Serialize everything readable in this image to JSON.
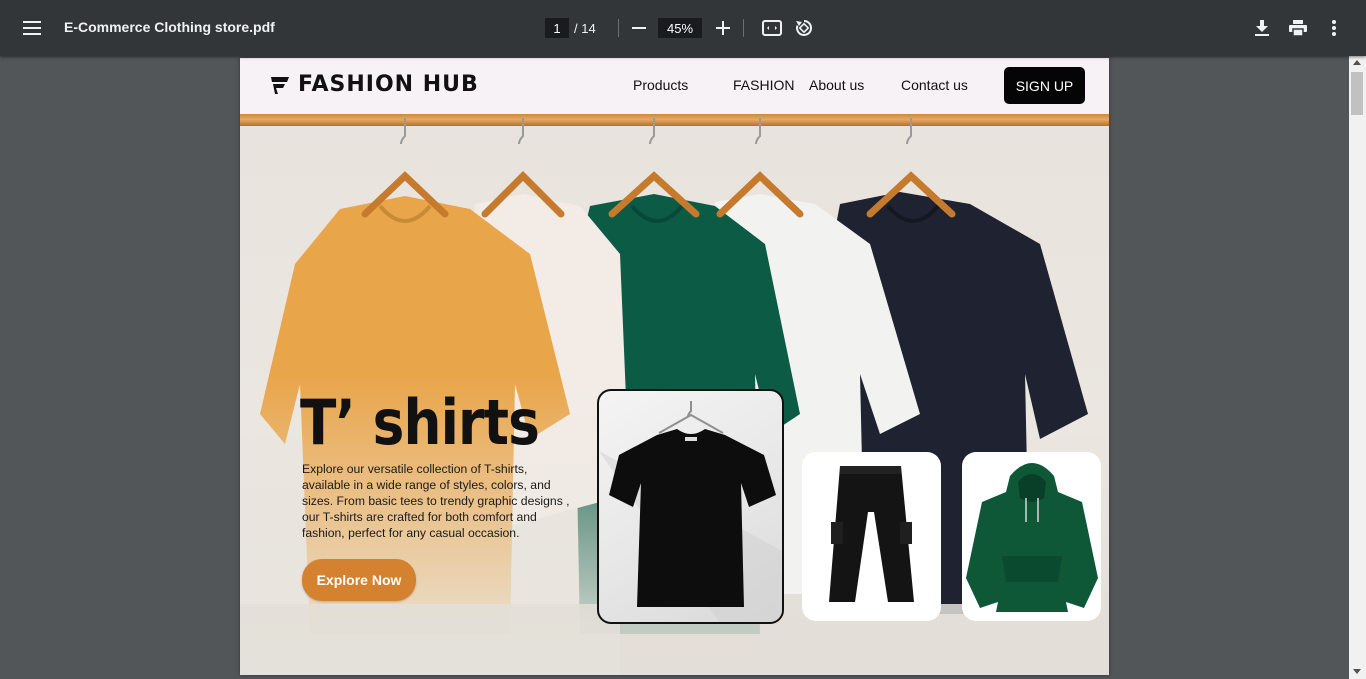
{
  "viewer": {
    "file_name": "E-Commerce Clothing store.pdf",
    "current_page": "1",
    "total_pages": "/ 14",
    "zoom": "45%"
  },
  "site": {
    "logo_text": "FASHION HUB",
    "nav": {
      "products": "Products",
      "fashion": "FASHION",
      "about": "About us",
      "contact": "Contact us"
    },
    "signup_label": "SIGN UP",
    "hero": {
      "title": "T’ shirts",
      "description": "Explore our versatile collection of T-shirts, available in a wide range of styles, colors, and sizes. From basic tees to trendy graphic designs , our T-shirts are crafted for both comfort and fashion, perfect for any casual occasion.",
      "cta": "Explore Now"
    },
    "carousel": {
      "slides": 4,
      "active": 1
    },
    "colors": {
      "accent": "#d4822f",
      "signup_bg": "#050505",
      "nav_bg": "#f7f2f6",
      "tee_colors": [
        "#e9a54a",
        "#f3ece6",
        "#0b5b45",
        "#f2f2f0",
        "#1f2230"
      ]
    }
  },
  "icons": [
    "menu-icon",
    "minus-icon",
    "plus-icon",
    "fit-page-icon",
    "rotate-icon",
    "download-icon",
    "print-icon",
    "more-vert-icon",
    "logo-mark-icon"
  ]
}
